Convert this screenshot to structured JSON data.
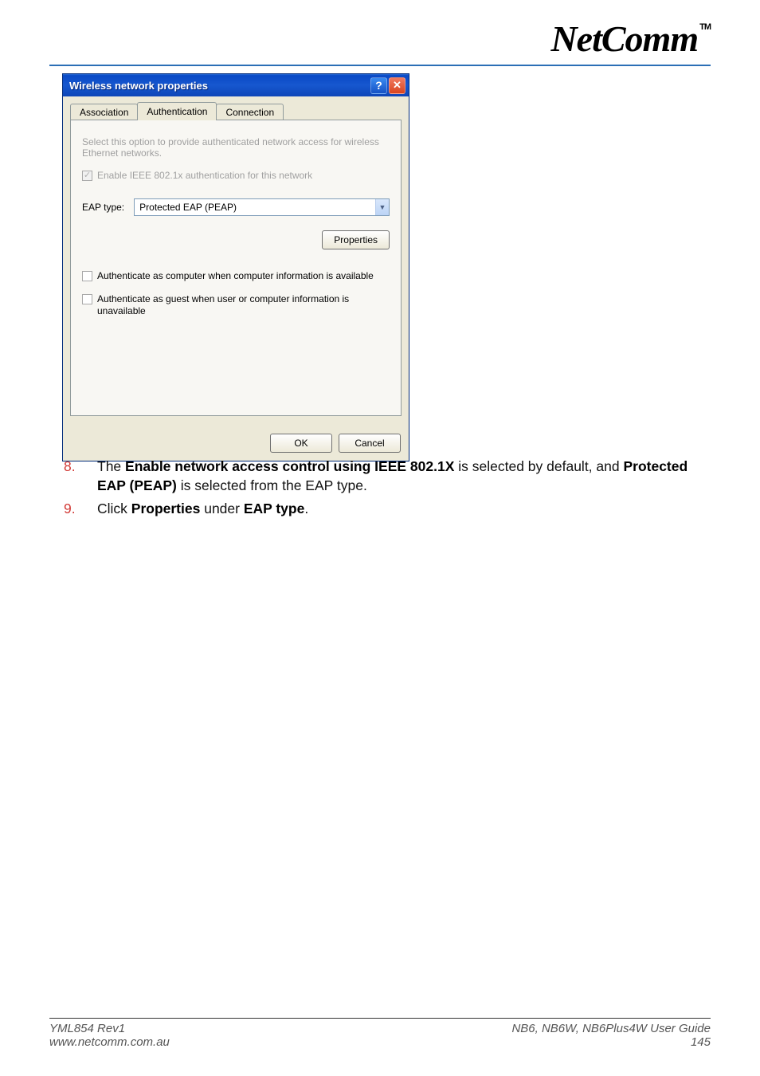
{
  "header": {
    "logo_text": "NetComm",
    "logo_tm": "TM"
  },
  "dialog": {
    "title": "Wireless network properties",
    "tabs": {
      "association": "Association",
      "authentication": "Authentication",
      "connection": "Connection"
    },
    "body": {
      "desc": "Select this option to provide authenticated network access for wireless Ethernet networks.",
      "enable_8021x_label": "Enable IEEE 802.1x authentication for this network",
      "eap_type_label": "EAP type:",
      "eap_type_value": "Protected EAP (PEAP)",
      "properties_btn": "Properties",
      "auth_computer_label": "Authenticate as computer when computer information is available",
      "auth_guest_label": "Authenticate as guest when user or computer information is unavailable"
    },
    "footer": {
      "ok": "OK",
      "cancel": "Cancel"
    }
  },
  "instructions": {
    "item8_num": "8.",
    "item8_pre": "The ",
    "item8_b1": "Enable network access control using IEEE 802.1X",
    "item8_mid": " is selected by default, and ",
    "item8_b2": "Protected EAP (PEAP)",
    "item8_post": " is selected from the EAP type.",
    "item9_num": "9.",
    "item9_pre": "Click ",
    "item9_b1": "Properties",
    "item9_mid": " under ",
    "item9_b2": "EAP type",
    "item9_post": "."
  },
  "footer": {
    "rev": "YML854 Rev1",
    "url": "www.netcomm.com.au",
    "product": "NB6, NB6W, NB6Plus4W",
    "guide": " User Guide",
    "page": "145"
  }
}
